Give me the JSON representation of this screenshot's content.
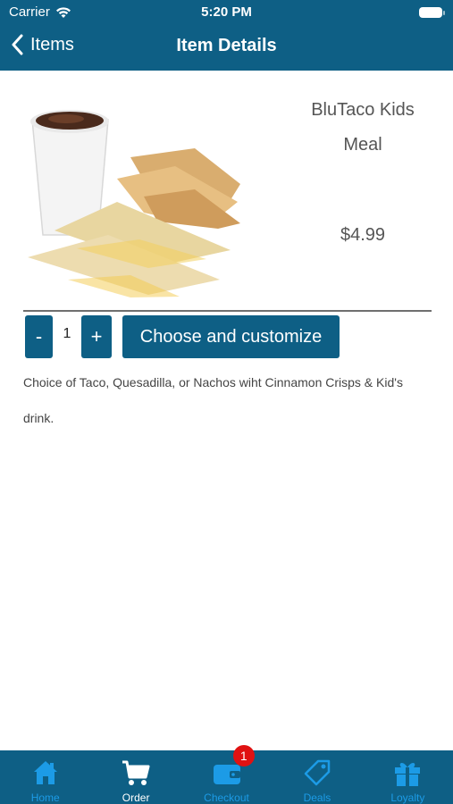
{
  "status_bar": {
    "carrier": "Carrier",
    "time": "5:20 PM"
  },
  "nav": {
    "back_label": "Items",
    "title": "Item Details"
  },
  "product": {
    "name": "BluTaco Kids Meal",
    "price": "$4.99",
    "quantity": "1",
    "minus_label": "-",
    "plus_label": "+",
    "customize_label": "Choose and customize",
    "description": "Choice of Taco, Quesadilla, or Nachos wiht Cinnamon Crisps & Kid's drink."
  },
  "tabs": [
    {
      "label": "Home",
      "icon": "home-icon"
    },
    {
      "label": "Order",
      "icon": "cart-icon"
    },
    {
      "label": "Checkout",
      "icon": "wallet-icon",
      "badge": "1"
    },
    {
      "label": "Deals",
      "icon": "tag-icon"
    },
    {
      "label": "Loyalty",
      "icon": "gift-icon"
    }
  ],
  "active_tab": "Order",
  "colors": {
    "brand": "#0e5f85",
    "tab_inactive": "#1c9be6",
    "badge": "#e01212",
    "text": "#555555"
  }
}
